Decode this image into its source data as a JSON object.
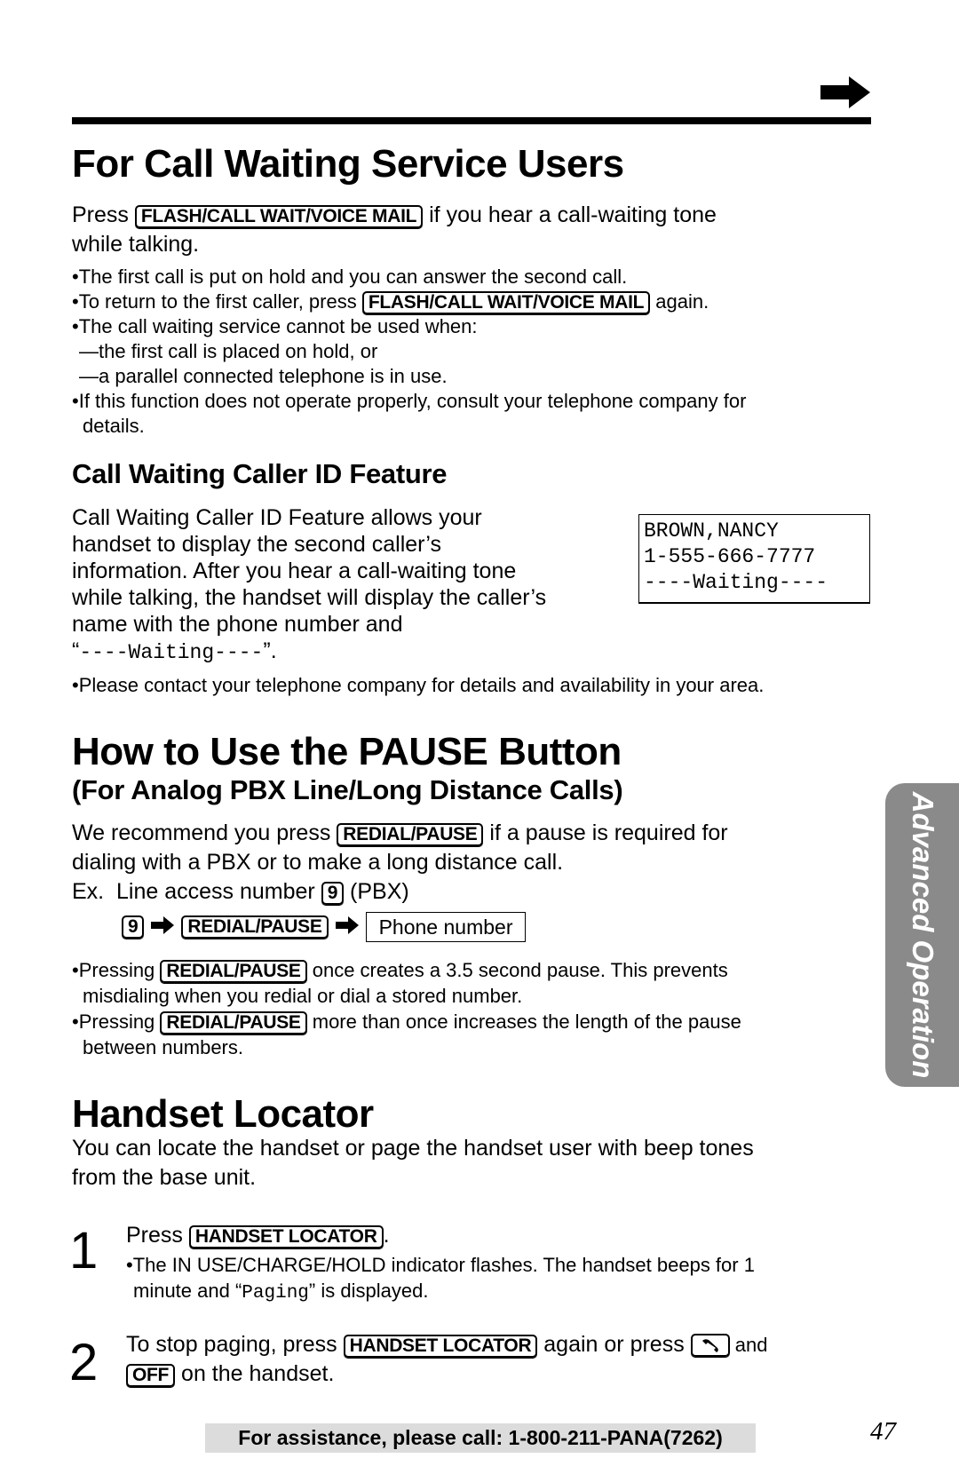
{
  "page": {
    "number": "47",
    "side_tab": "Advanced Operation",
    "footer": "For assistance, please call: 1-800-211-PANA(7262)"
  },
  "icons": {
    "next_page": "arrow-right-icon",
    "flow_arrow": "arrow-right-icon",
    "talk_key": "handset-icon"
  },
  "call_waiting": {
    "title": "For Call Waiting Service Users",
    "intro_before": "Press ",
    "intro_key": "FLASH/CALL WAIT/VOICE MAIL",
    "intro_after": " if you hear a call-waiting tone",
    "intro_line2": "while talking.",
    "bullets": [
      "•The first call is put on hold and you can answer the second call.",
      "•To return to the first caller, press ",
      "•The call waiting service cannot be used when:",
      "—the first call is placed on hold, or",
      "—a parallel connected telephone is in use.",
      "•If this function does not operate properly, consult your telephone company for",
      "details."
    ],
    "bullet2_key": "FLASH/CALL WAIT/VOICE MAIL",
    "bullet2_after": " again."
  },
  "caller_id": {
    "title": "Call Waiting Caller ID Feature",
    "lines": [
      "Call Waiting Caller ID Feature allows your",
      "handset to display the second caller’s",
      "information. After you hear a call-waiting tone",
      "while talking, the handset will display the caller’s",
      "name with the phone number and"
    ],
    "last_open": "“",
    "last_mono": "----Waiting----",
    "last_close": "”.",
    "display": [
      "BROWN,NANCY",
      "1-555-666-7777",
      "----Waiting----"
    ],
    "note": "•Please contact your telephone company for details and availability in your area."
  },
  "pause": {
    "title": "How to Use the PAUSE Button",
    "subtitle": "(For Analog PBX Line/Long Distance Calls)",
    "intro_before": "We recommend you press ",
    "intro_key": "REDIAL/PAUSE",
    "intro_after": " if a pause is required for",
    "intro_line2": "dialing with a PBX or to make a long distance call.",
    "example_before": "Ex.  Line access number ",
    "example_key": "9",
    "example_after": " (PBX)",
    "flow": {
      "key1": "9",
      "key2": "REDIAL/PAUSE",
      "box": "Phone number"
    },
    "bullet1_before": "•Pressing ",
    "bullet1_key": "REDIAL/PAUSE",
    "bullet1_after": " once creates a 3.5 second pause. This prevents",
    "bullet1_line2": "misdialing when you redial or dial a stored number.",
    "bullet2_before": "•Pressing ",
    "bullet2_key": "REDIAL/PAUSE",
    "bullet2_after": " more than once increases the length of the pause",
    "bullet2_line2": "between numbers."
  },
  "locator": {
    "title": "Handset Locator",
    "intro_line1": "You can locate the handset or page the handset user with beep tones",
    "intro_line2": "from the base unit.",
    "step1": {
      "num": "1",
      "before": "Press ",
      "key": "HANDSET LOCATOR",
      "after": ".",
      "note_line1": "•The IN USE/CHARGE/HOLD indicator flashes. The handset beeps for 1",
      "note_line2_before": "minute and “",
      "note_line2_mono": "Paging",
      "note_line2_after": "” is displayed."
    },
    "step2": {
      "num": "2",
      "before": "To stop paging, press ",
      "key": "HANDSET LOCATOR",
      "middle": " again or press ",
      "after": " and",
      "key2": "OFF",
      "line2_after": " on the handset."
    }
  }
}
